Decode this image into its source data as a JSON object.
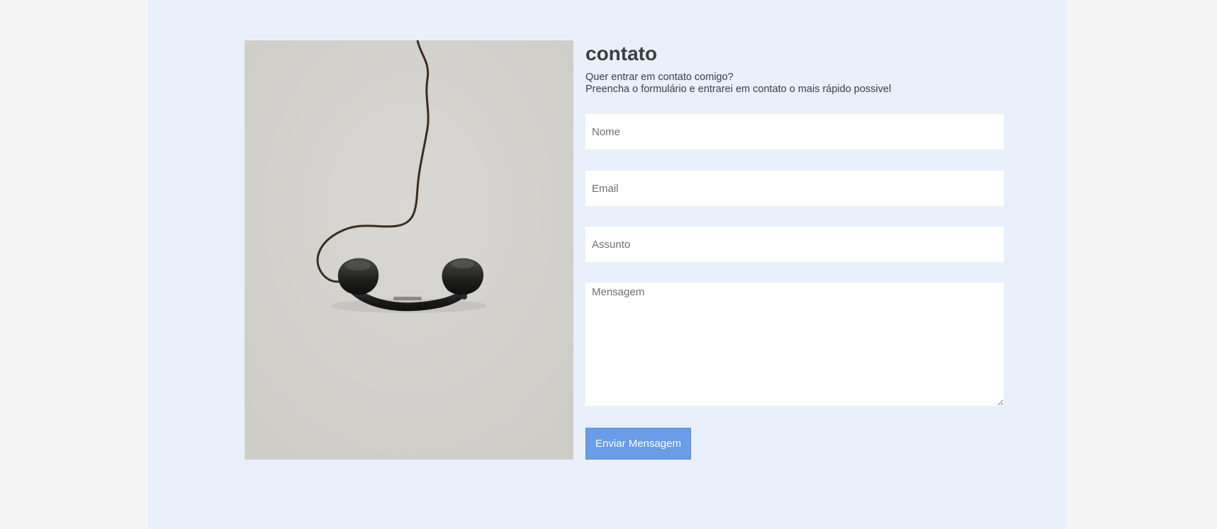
{
  "contact": {
    "title": "contato",
    "subtitle_line1": "Quer entrar em contato comigo?",
    "subtitle_line2": "Preencha o formulário e entrarei em contato o mais rápido possivel"
  },
  "form": {
    "name_placeholder": "Nome",
    "email_placeholder": "Email",
    "subject_placeholder": "Assunto",
    "message_placeholder": "Mensagem",
    "submit_label": "Enviar Mensagem"
  },
  "colors": {
    "page_background": "#f4f4f4",
    "section_background": "#e9f0fc",
    "button": "#6a9ce8",
    "text": "#3a3f45",
    "photo_background": "#d5d4d0"
  }
}
